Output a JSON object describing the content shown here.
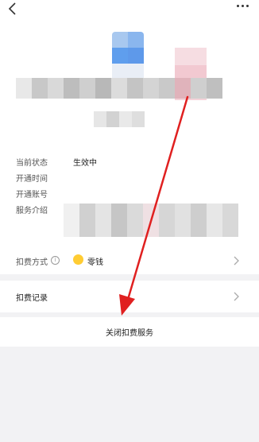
{
  "nav": {
    "back_icon": "chevron-left-icon",
    "more_icon": "more-dots-icon"
  },
  "details": {
    "status_label": "当前状态",
    "status_value": "生效中",
    "open_time_label": "开通时间",
    "open_account_label": "开通账号",
    "service_desc_label": "服务介绍"
  },
  "payment": {
    "label": "扣费方式",
    "value": "零钱"
  },
  "records": {
    "label": "扣费记录"
  },
  "cancel": {
    "label": "关闭扣费服务"
  },
  "colors": {
    "annotation_arrow": "#e02020",
    "coin": "#ffcc33"
  }
}
